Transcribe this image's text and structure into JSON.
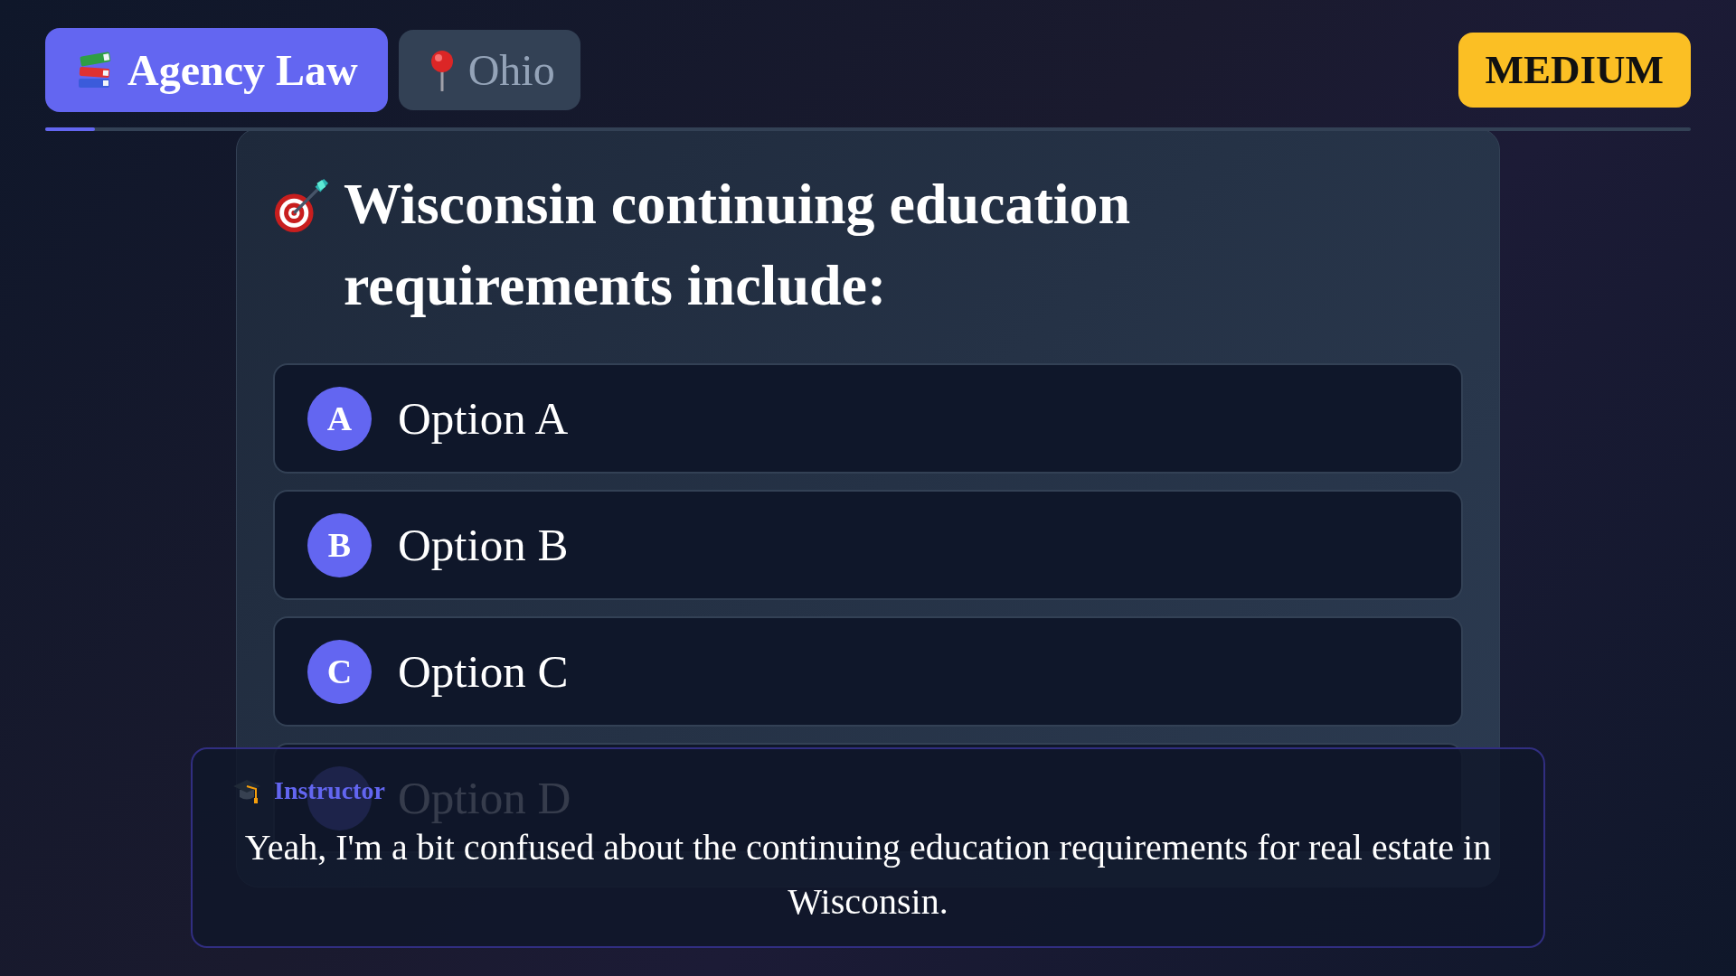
{
  "header": {
    "tags": [
      {
        "kind": "topic",
        "label": "Agency Law"
      },
      {
        "kind": "location",
        "label": "Ohio"
      }
    ],
    "difficulty": "MEDIUM"
  },
  "progress": {
    "level": 0.03
  },
  "question": {
    "text": "Wisconsin continuing education requirements include:",
    "options": [
      {
        "letter": "A",
        "text": "Option A"
      },
      {
        "letter": "B",
        "text": "Option B"
      },
      {
        "letter": "C",
        "text": "Option C"
      },
      {
        "text": "Option D"
      }
    ]
  },
  "caption": {
    "speaker": "Instructor",
    "message": "Yeah, I'm a bit confused about the continuing education requirements for real estate in Wisconsin."
  }
}
